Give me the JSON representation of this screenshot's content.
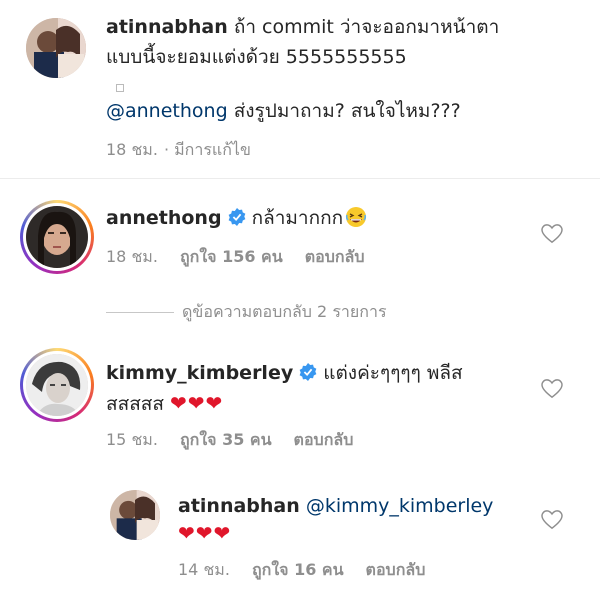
{
  "post_caption": {
    "username": "atinnabhan",
    "text_line1": "ถ้า commit ว่าจะออกมาหน้าตา",
    "text_line2": "แบบนี้จะยอมแต่งด้วย 5555555555",
    "mention": "@annethong",
    "text_line3": "ส่งรูปมาถาม? สนใจไหม???",
    "time": "18 ชม.",
    "edited": "· มีการแก้ไข"
  },
  "comments": [
    {
      "username": "annethong",
      "verified": true,
      "text": "กล้ามากกก",
      "emoji": "laughing-emoji",
      "time": "18 ชม.",
      "likes": "ถูกใจ 156 คน",
      "reply": "ตอบกลับ"
    },
    {
      "view_replies": "ดูข้อความตอบกลับ 2 รายการ"
    },
    {
      "username": "kimmy_kimberley",
      "verified": true,
      "text_line1": "แต่งค่ะๆๆๆๆ พลีส",
      "text_line2": "สสสสส",
      "hearts": "❤❤❤",
      "time": "15 ชม.",
      "likes": "ถูกใจ 35 คน",
      "reply": "ตอบกลับ"
    },
    {
      "username": "atinnabhan",
      "mention": "@kimmy_kimberley",
      "hearts": "❤❤❤",
      "time": "14 ชม.",
      "likes": "ถูกใจ 16 คน",
      "reply": "ตอบกลับ"
    }
  ],
  "colors": {
    "text": "#262626",
    "muted": "#8e8e8e",
    "mention": "#00376b",
    "verified": "#3897f0",
    "heart": "#e0162b"
  }
}
